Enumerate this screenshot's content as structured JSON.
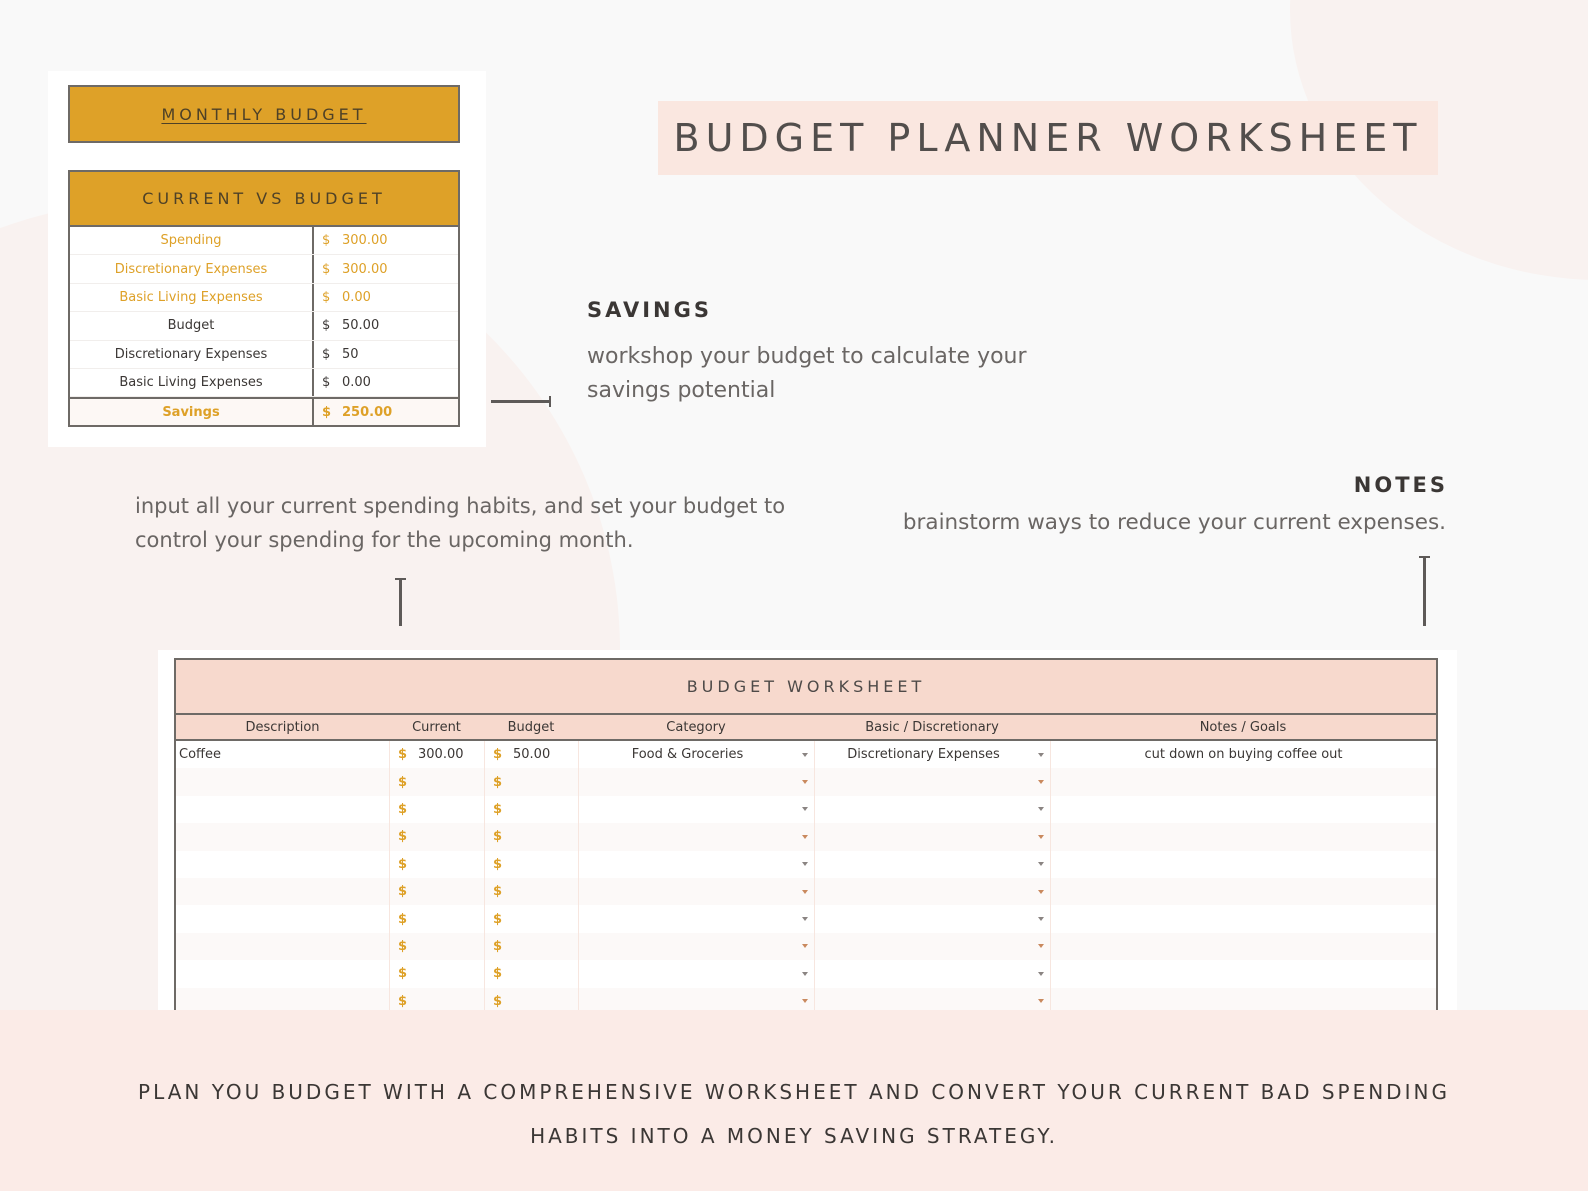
{
  "title": "BUDGET PLANNER WORKSHEET",
  "monthly_budget": {
    "header": "MONTHLY BUDGET",
    "current_vs_budget": {
      "header": "CURRENT VS BUDGET",
      "rows": [
        {
          "label": "Spending",
          "currency": "$",
          "value": "300.00",
          "style": "gold"
        },
        {
          "label": "Discretionary Expenses",
          "currency": "$",
          "value": "300.00",
          "style": "gold"
        },
        {
          "label": "Basic Living Expenses",
          "currency": "$",
          "value": "0.00",
          "style": "gold"
        },
        {
          "label": "Budget",
          "currency": "$",
          "value": "50.00",
          "style": "dark"
        },
        {
          "label": "Discretionary Expenses",
          "currency": "$",
          "value": "50",
          "style": "dark"
        },
        {
          "label": "Basic Living Expenses",
          "currency": "$",
          "value": "0.00",
          "style": "dark"
        },
        {
          "label": "Savings",
          "currency": "$",
          "value": "250.00",
          "style": "savings"
        }
      ]
    }
  },
  "callouts": {
    "savings_heading": "SAVINGS",
    "savings_text": "workshop your budget to calculate your savings potential",
    "input_text": "input all your current spending habits, and set your budget to control your spending for the upcoming month.",
    "notes_heading": "NOTES",
    "notes_text": "brainstorm ways to reduce your current expenses."
  },
  "worksheet": {
    "title": "BUDGET WORKSHEET",
    "columns": [
      "Description",
      "Current",
      "Budget",
      "Category",
      "Basic / Discretionary",
      "Notes / Goals"
    ],
    "rows": [
      {
        "description": "Coffee",
        "current": "300.00",
        "budget": "50.00",
        "category": "Food & Groceries",
        "type": "Discretionary Expenses",
        "notes": "cut down on buying coffee out"
      },
      {
        "description": "",
        "current": "",
        "budget": "",
        "category": "",
        "type": "",
        "notes": ""
      },
      {
        "description": "",
        "current": "",
        "budget": "",
        "category": "",
        "type": "",
        "notes": ""
      },
      {
        "description": "",
        "current": "",
        "budget": "",
        "category": "",
        "type": "",
        "notes": ""
      },
      {
        "description": "",
        "current": "",
        "budget": "",
        "category": "",
        "type": "",
        "notes": ""
      },
      {
        "description": "",
        "current": "",
        "budget": "",
        "category": "",
        "type": "",
        "notes": ""
      },
      {
        "description": "",
        "current": "",
        "budget": "",
        "category": "",
        "type": "",
        "notes": ""
      },
      {
        "description": "",
        "current": "",
        "budget": "",
        "category": "",
        "type": "",
        "notes": ""
      },
      {
        "description": "",
        "current": "",
        "budget": "",
        "category": "",
        "type": "",
        "notes": ""
      },
      {
        "description": "",
        "current": "",
        "budget": "",
        "category": "",
        "type": "",
        "notes": ""
      }
    ],
    "currency_symbol": "$"
  },
  "footer": {
    "line1": "PLAN YOU BUDGET WITH A COMPREHENSIVE WORKSHEET AND CONVERT YOUR CURRENT BAD SPENDING",
    "line2": "HABITS INTO A MONEY SAVING STRATEGY."
  },
  "colors": {
    "gold": "#dea128",
    "peach": "#f7d9cd",
    "title_bg": "#fae7e0",
    "footer_bg": "#fbebe7",
    "text_dark": "#3b3735",
    "text_gray": "#6a6664"
  }
}
